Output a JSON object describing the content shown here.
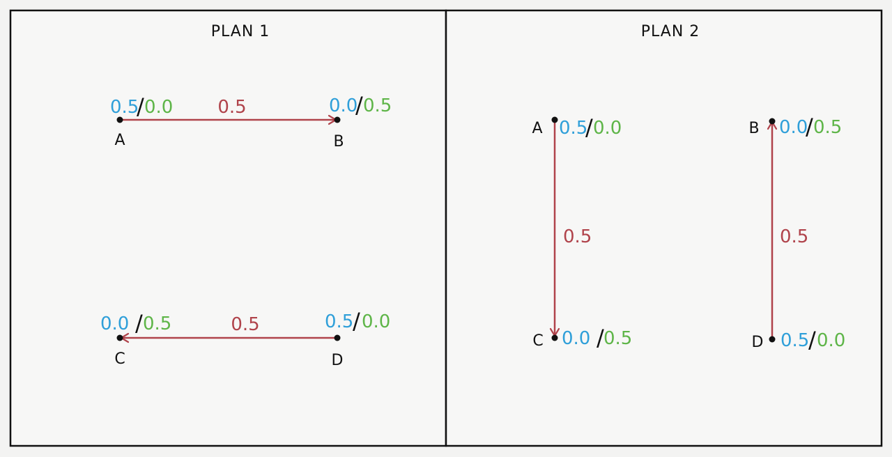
{
  "colors": {
    "edge": "#b0434b",
    "blue_value": "#2f9fd9",
    "green_value": "#5eb548",
    "ink": "#111111",
    "background": "#f3f3f2"
  },
  "panels": [
    {
      "title": "PLAN 1",
      "nodes": [
        {
          "label": "A",
          "value_left": "0.5",
          "value_right": "0.0"
        },
        {
          "label": "B",
          "value_left": "0.0",
          "value_right": "0.5"
        },
        {
          "label": "C",
          "value_left": "0.0",
          "value_right": "0.5"
        },
        {
          "label": "D",
          "value_left": "0.5",
          "value_right": "0.0"
        }
      ],
      "edges": [
        {
          "from": "A",
          "to": "B",
          "label": "0.5"
        },
        {
          "from": "D",
          "to": "C",
          "label": "0.5"
        }
      ]
    },
    {
      "title": "PLAN 2",
      "nodes": [
        {
          "label": "A",
          "value_left": "0.5",
          "value_right": "0.0"
        },
        {
          "label": "B",
          "value_left": "0.0",
          "value_right": "0.5"
        },
        {
          "label": "C",
          "value_left": "0.0",
          "value_right": "0.5"
        },
        {
          "label": "D",
          "value_left": "0.5",
          "value_right": "0.0"
        }
      ],
      "edges": [
        {
          "from": "A",
          "to": "C",
          "label": "0.5"
        },
        {
          "from": "D",
          "to": "B",
          "label": "0.5"
        }
      ]
    }
  ]
}
